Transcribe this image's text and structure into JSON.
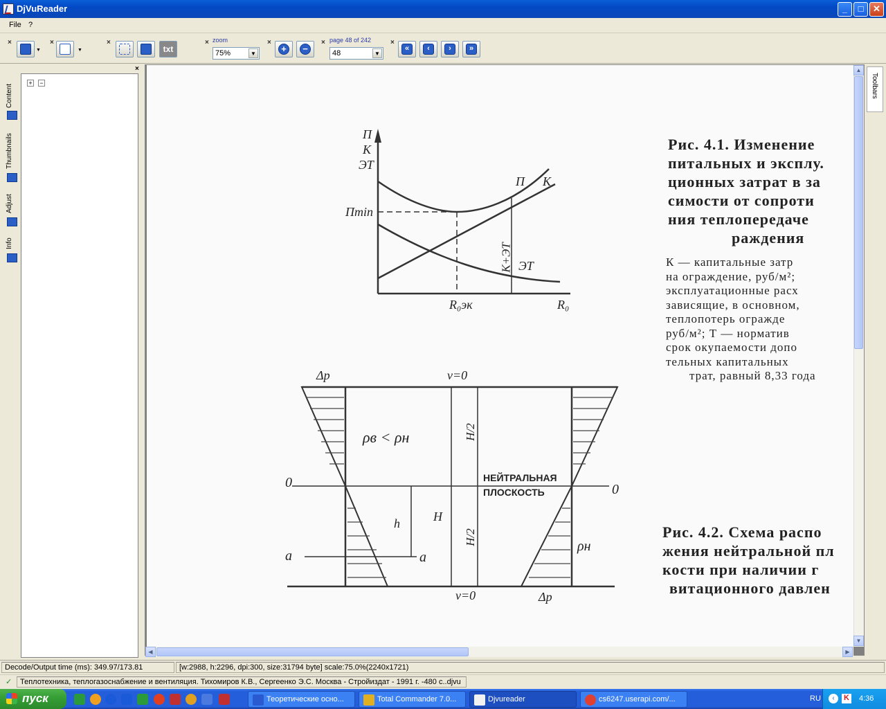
{
  "window": {
    "title": "DjVuReader",
    "minimize": "_",
    "maximize": "□",
    "close": "✕"
  },
  "menu": {
    "file": "File",
    "help": "?"
  },
  "toolbar": {
    "close_glyph": "×",
    "txt_label": "txt",
    "zoom": {
      "label": "zoom",
      "value": "75%"
    },
    "page": {
      "label": "page 48 of 242",
      "value": "48"
    }
  },
  "left_tabs": [
    "Content",
    "Thumbnails",
    "Adjust",
    "Info"
  ],
  "right_tab": "Toolbars",
  "document": {
    "fig1": {
      "caption_lines": [
        "Рис. 4.1. Изменение",
        "питальных и эксплу.",
        "ционных затрат в за",
        "симости от сопроти",
        "ния теплопередаче",
        "раждения"
      ],
      "body_lines": [
        "К — капитальные затр",
        "на ограждение, руб/м²;",
        "эксплуатационные расх",
        "зависящие, в основном,",
        "теплопотерь огражде",
        "руб/м²; Т — норматив",
        "срок окупаемости допо",
        "тельных капитальных",
        "трат, равный 8,33 года"
      ],
      "labels": {
        "y_axis": "П",
        "y_axis2": "К",
        "y_axis3": "ЭТ",
        "pmin": "Пmin",
        "curve_p": "П",
        "curve_k": "К",
        "curve_kst": "К+ЭТ",
        "curve_et": "ЭТ",
        "x_r0ek": "R₀эк",
        "x_r0": "R₀"
      }
    },
    "fig2": {
      "caption_lines": [
        "Рис. 4.2. Схема распо",
        "жения нейтральной пл",
        "кости при наличии г",
        "витационного давлен"
      ],
      "labels": {
        "dp_top": "Δp",
        "v0_top": "v=0",
        "rho": "ρв < ρн",
        "h2_top": "H/2",
        "zero_left": "0",
        "zero_right": "0",
        "neutral1": "НЕЙТРАЛЬНАЯ",
        "neutral2": "ПЛОСКОСТЬ",
        "h": "h",
        "H": "H",
        "h2_bottom": "H/2",
        "a_left": "a",
        "a_right": "a",
        "rho_n": "ρн",
        "v0_bottom": "v=0",
        "dp_bottom": "Δp"
      }
    }
  },
  "status": {
    "timing": "Decode/Output time (ms): 349.97/173.81",
    "info": "[w:2988, h:2296, dpi:300, size:31794 byte] scale:75.0%(2240x1721)",
    "file": "Теплотехника, теплогазоснабжение и вентиляция. Тихомиров К.В., Сергеенко Э.С. Москва - Стройиздат - 1991 г. -480 с..djvu"
  },
  "taskbar": {
    "start": "пуск",
    "tasks": [
      "Теоретические осно...",
      "Total Commander 7.0...",
      "Djvureader",
      "cs6247.userapi.com/..."
    ],
    "lang": "RU",
    "clock": "4:36"
  }
}
